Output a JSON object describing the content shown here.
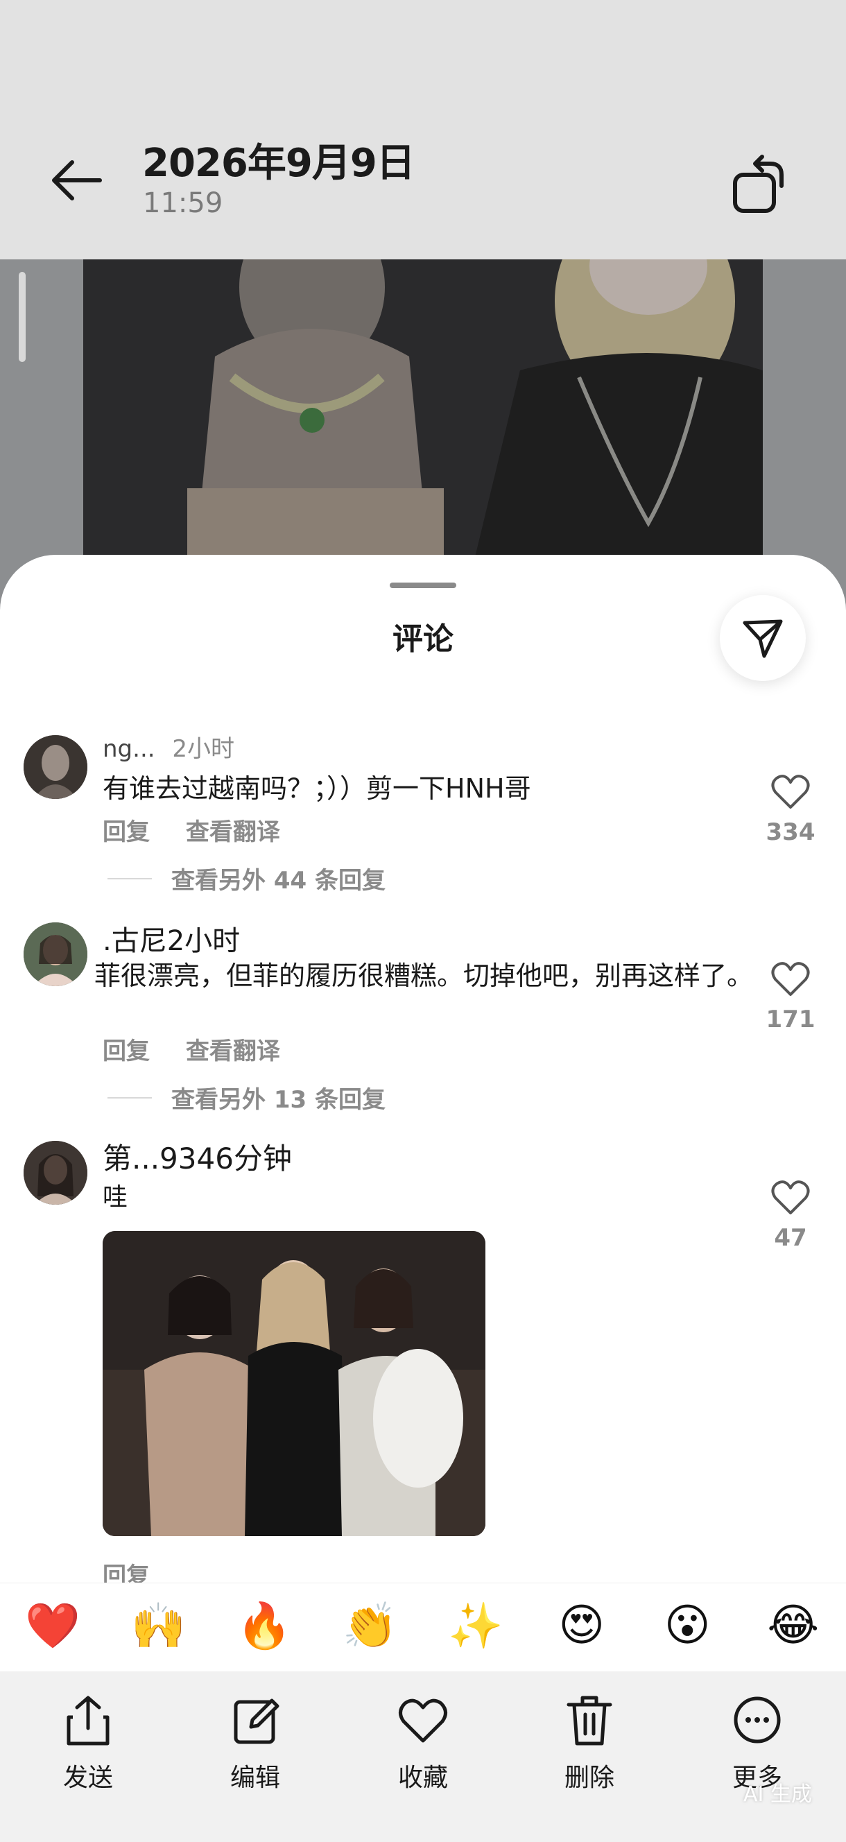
{
  "header": {
    "date": "2026年9月9日",
    "time": "11:59"
  },
  "sheet": {
    "title": "评论"
  },
  "comments": [
    {
      "author": "ng...",
      "time": "2小时",
      "text": "有谁去过越南吗？；））剪一下HNH哥",
      "reply_label": "回复",
      "translate_label": "查看翻译",
      "more_replies": "查看另外 44 条回复",
      "likes": "334"
    },
    {
      "author": ".古尼2小时",
      "text": "菲很漂亮，但菲的履历很糟糕。切掉他吧，别再这样了。",
      "reply_label": "回复",
      "translate_label": "查看翻译",
      "more_replies": "查看另外 13 条回复",
      "likes": "171"
    },
    {
      "author": "第...9346分钟",
      "text": "哇",
      "reply_label": "回复",
      "likes": "47"
    }
  ],
  "reactions": [
    "❤️",
    "🙌",
    "🔥",
    "👏",
    "✨",
    "😍",
    "😮",
    "😂"
  ],
  "toolbar": {
    "send": "发送",
    "edit": "编辑",
    "favorite": "收藏",
    "delete": "删除",
    "more": "更多"
  },
  "watermark": "AI 生成",
  "colors": {
    "heart": "#e0243a",
    "muted_text": "#8a8a8a",
    "sheet_bg": "#ffffff",
    "topbar_bg": "#e2e2e2"
  },
  "icons": [
    "back-arrow-icon",
    "rotate-icon",
    "send-icon",
    "heart-outline-icon",
    "share-icon",
    "edit-icon",
    "trash-icon",
    "more-icon"
  ]
}
